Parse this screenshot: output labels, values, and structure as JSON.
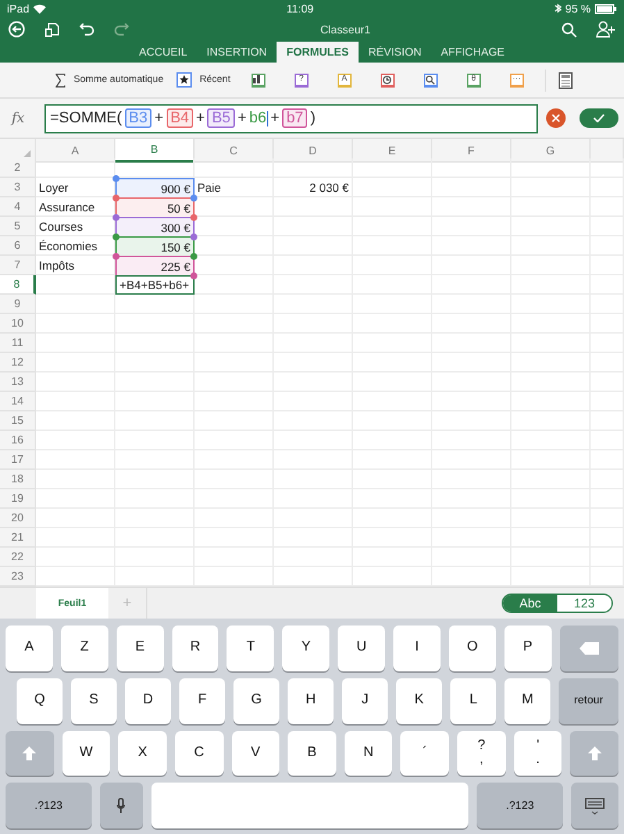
{
  "status_bar": {
    "device": "iPad",
    "time": "11:09",
    "battery": "95 %"
  },
  "title_bar": {
    "title": "Classeur1"
  },
  "tabs": [
    {
      "label": "ACCUEIL",
      "selected": false
    },
    {
      "label": "INSERTION",
      "selected": false
    },
    {
      "label": "FORMULES",
      "selected": true
    },
    {
      "label": "RÉVISION",
      "selected": false
    },
    {
      "label": "AFFICHAGE",
      "selected": false
    }
  ],
  "ribbon": {
    "autosum": "Somme automatique",
    "recent": "Récent",
    "categories": [
      {
        "kind": "chart",
        "color": "#5aa363"
      },
      {
        "kind": "glyph",
        "glyph": "?",
        "color": "#9b6bd6"
      },
      {
        "kind": "glyph",
        "glyph": "A",
        "color": "#e2b63c"
      },
      {
        "kind": "clock",
        "color": "#e0605e"
      },
      {
        "kind": "search",
        "color": "#5b8def"
      },
      {
        "kind": "glyph",
        "glyph": "θ",
        "color": "#5aa363"
      },
      {
        "kind": "glyph",
        "glyph": "···",
        "color": "#f0a04b"
      }
    ]
  },
  "formula_bar": {
    "label": "fx",
    "parts": [
      {
        "kind": "text",
        "text": "=SOMME("
      },
      {
        "kind": "ref",
        "text": "B3",
        "color": "#5b8def"
      },
      {
        "kind": "text",
        "text": "+"
      },
      {
        "kind": "ref",
        "text": "B4",
        "color": "#e8666a"
      },
      {
        "kind": "text",
        "text": "+"
      },
      {
        "kind": "ref",
        "text": "B5",
        "color": "#9b6bd6"
      },
      {
        "kind": "text",
        "text": "+"
      },
      {
        "kind": "cursor",
        "text": "b6",
        "color": "#3a9a45"
      },
      {
        "kind": "text",
        "text": "+"
      },
      {
        "kind": "ref",
        "text": "b7",
        "color": "#d0559a"
      },
      {
        "kind": "text",
        "text": ")"
      }
    ]
  },
  "sheet": {
    "columns": [
      {
        "label": "A",
        "selected": false
      },
      {
        "label": "B",
        "selected": true
      },
      {
        "label": "C",
        "selected": false
      },
      {
        "label": "D",
        "selected": false
      },
      {
        "label": "E",
        "selected": false
      },
      {
        "label": "F",
        "selected": false
      },
      {
        "label": "G",
        "selected": false
      }
    ],
    "rows": [
      {
        "header": "2",
        "active": false
      },
      {
        "header": "3",
        "active": false,
        "label": "Loyer",
        "amount": "900 €",
        "note": "Paie",
        "total": "2 030 €",
        "color": "#5b8def"
      },
      {
        "header": "4",
        "active": false,
        "label": "Assurance",
        "amount": "50 €",
        "color": "#e8666a"
      },
      {
        "header": "5",
        "active": false,
        "label": "Courses",
        "amount": "300 €",
        "color": "#9b6bd6"
      },
      {
        "header": "6",
        "active": false,
        "label": "Économies",
        "amount": "150 €",
        "color": "#3a9a45"
      },
      {
        "header": "7",
        "active": false,
        "label": "Impôts",
        "amount": "225 €",
        "color": "#d0559a"
      },
      {
        "header": "8",
        "active": true,
        "amount": "+B4+B5+b6+",
        "editing": true
      },
      {
        "header": "9",
        "active": false
      },
      {
        "header": "10",
        "active": false
      },
      {
        "header": "11",
        "active": false
      },
      {
        "header": "12",
        "active": false
      },
      {
        "header": "13",
        "active": false
      },
      {
        "header": "14",
        "active": false
      },
      {
        "header": "15",
        "active": false
      },
      {
        "header": "16",
        "active": false
      },
      {
        "header": "17",
        "active": false
      },
      {
        "header": "18",
        "active": false
      },
      {
        "header": "19",
        "active": false
      },
      {
        "header": "20",
        "active": false
      },
      {
        "header": "21",
        "active": false
      },
      {
        "header": "22",
        "active": false
      },
      {
        "header": "23",
        "active": false
      }
    ]
  },
  "sheet_tabs": [
    {
      "label": "Feuil1",
      "selected": true
    }
  ],
  "add_sheet": "+",
  "input_mode": [
    {
      "label": "Abc",
      "selected": true
    },
    {
      "label": "123",
      "selected": false
    }
  ],
  "keyboard": {
    "rows": [
      {
        "keys": [
          {
            "kind": "letter",
            "label": "A"
          },
          {
            "kind": "letter",
            "label": "Z"
          },
          {
            "kind": "letter",
            "label": "E"
          },
          {
            "kind": "letter",
            "label": "R"
          },
          {
            "kind": "letter",
            "label": "T"
          },
          {
            "kind": "letter",
            "label": "Y"
          },
          {
            "kind": "letter",
            "label": "U"
          },
          {
            "kind": "letter",
            "label": "I"
          },
          {
            "kind": "letter",
            "label": "O"
          },
          {
            "kind": "letter",
            "label": "P"
          },
          {
            "kind": "delete"
          }
        ]
      },
      {
        "keys": [
          {
            "kind": "letter",
            "label": "Q"
          },
          {
            "kind": "letter",
            "label": "S"
          },
          {
            "kind": "letter",
            "label": "D"
          },
          {
            "kind": "letter",
            "label": "F"
          },
          {
            "kind": "letter",
            "label": "G"
          },
          {
            "kind": "letter",
            "label": "H"
          },
          {
            "kind": "letter",
            "label": "J"
          },
          {
            "kind": "letter",
            "label": "K"
          },
          {
            "kind": "letter",
            "label": "L"
          },
          {
            "kind": "letter",
            "label": "M"
          },
          {
            "kind": "return",
            "label": "retour"
          }
        ]
      },
      {
        "keys": [
          {
            "kind": "shift"
          },
          {
            "kind": "letter",
            "label": "W"
          },
          {
            "kind": "letter",
            "label": "X"
          },
          {
            "kind": "letter",
            "label": "C"
          },
          {
            "kind": "letter",
            "label": "V"
          },
          {
            "kind": "letter",
            "label": "B"
          },
          {
            "kind": "letter",
            "label": "N"
          },
          {
            "kind": "letter",
            "label": "´"
          },
          {
            "kind": "dual",
            "top": "?",
            "bottom": ","
          },
          {
            "kind": "dual",
            "top": "'",
            "bottom": "."
          },
          {
            "kind": "shift"
          }
        ]
      },
      {
        "keys": [
          {
            "kind": "mode",
            "label": ".?123"
          },
          {
            "kind": "mic"
          },
          {
            "kind": "space"
          },
          {
            "kind": "mode",
            "label": ".?123"
          },
          {
            "kind": "hide"
          }
        ]
      }
    ]
  }
}
